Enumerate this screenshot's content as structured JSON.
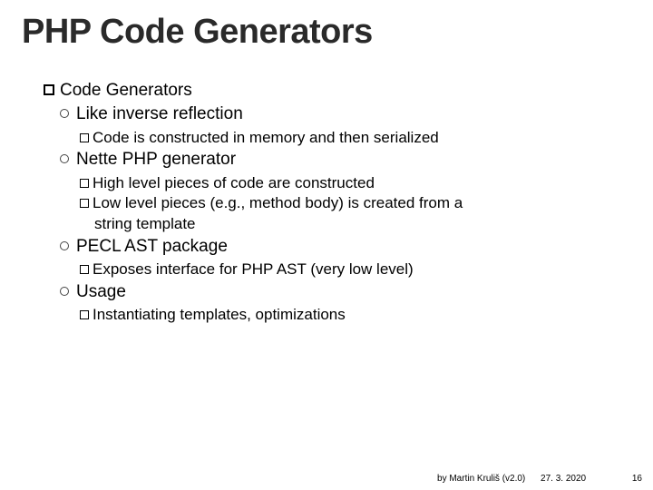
{
  "title": "PHP Code Generators",
  "l1": {
    "text": "Code Generators"
  },
  "items": {
    "a": {
      "label": "Like inverse reflection",
      "sub1": "Code is constructed in memory and then serialized"
    },
    "b": {
      "label": "Nette PHP generator",
      "sub1": "High level pieces of code are constructed",
      "sub2a": "Low level pieces (e.g., method body) is created from a",
      "sub2b": "string template"
    },
    "c": {
      "label": "PECL AST package",
      "sub1": "Exposes interface for PHP AST (very low level)"
    },
    "d": {
      "label": "Usage",
      "sub1": "Instantiating templates, optimizations"
    }
  },
  "footer": {
    "author": "by Martin Kruliš (v2.0)",
    "date": "27. 3. 2020",
    "page": "16"
  }
}
